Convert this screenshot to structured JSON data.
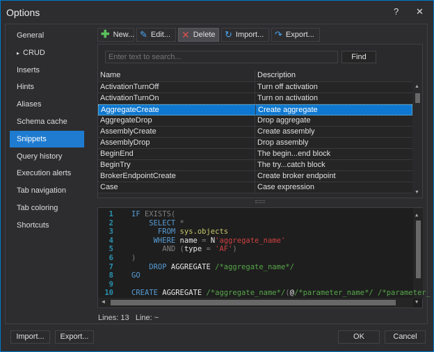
{
  "window": {
    "title": "Options",
    "help": "?",
    "close": "✕"
  },
  "sidebar": {
    "items": [
      {
        "label": "General"
      },
      {
        "label": "CRUD",
        "expander": "▸"
      },
      {
        "label": "Inserts"
      },
      {
        "label": "Hints"
      },
      {
        "label": "Aliases"
      },
      {
        "label": "Schema cache"
      },
      {
        "label": "Snippets",
        "selected": true
      },
      {
        "label": "Query history"
      },
      {
        "label": "Execution alerts"
      },
      {
        "label": "Tab navigation"
      },
      {
        "label": "Tab coloring"
      },
      {
        "label": "Shortcuts"
      }
    ]
  },
  "toolbar": {
    "new": "New...",
    "edit": "Edit...",
    "delete": "Delete",
    "import": "Import...",
    "export": "Export..."
  },
  "search": {
    "placeholder": "Enter text to search...",
    "find": "Find"
  },
  "table": {
    "headers": [
      "Name",
      "Description"
    ],
    "selected_index": 2,
    "rows": [
      [
        "ActivationTurnOff",
        "Turn off activation"
      ],
      [
        "ActivationTurnOn",
        "Turn on activation"
      ],
      [
        "AggregateCreate",
        "Create aggregate"
      ],
      [
        "AggregateDrop",
        "Drop aggregate"
      ],
      [
        "AssemblyCreate",
        "Create assembly"
      ],
      [
        "AssemblyDrop",
        "Drop assembly"
      ],
      [
        "BeginEnd",
        "The begin...end block"
      ],
      [
        "BeginTry",
        "The try...catch block"
      ],
      [
        "BrokerEndpointCreate",
        "Create broker endpoint"
      ],
      [
        "Case",
        "Case expression"
      ]
    ]
  },
  "editor": {
    "line_numbers": [
      "1",
      "2",
      "3",
      "4",
      "5",
      "6",
      "7",
      "8",
      "9",
      "10"
    ],
    "lines": [
      [
        [
          "kw",
          "IF "
        ],
        [
          "gr",
          "EXISTS("
        ]
      ],
      [
        [
          "kw",
          "    SELECT "
        ],
        [
          "gr",
          "*"
        ]
      ],
      [
        [
          "kw",
          "      FROM "
        ],
        [
          "ob",
          "sys.objects"
        ]
      ],
      [
        [
          "kw",
          "     WHERE "
        ],
        [
          "wh",
          "name "
        ],
        [
          "gr",
          "= "
        ],
        [
          "wh",
          "N"
        ],
        [
          "st",
          "'aggregate_name'"
        ]
      ],
      [
        [
          "gr",
          "       AND ("
        ],
        [
          "wh",
          "type "
        ],
        [
          "gr",
          "= "
        ],
        [
          "st",
          "'AF'"
        ],
        [
          "gr",
          ")"
        ]
      ],
      [
        [
          "gr",
          ")"
        ]
      ],
      [
        [
          "kw",
          "    DROP "
        ],
        [
          "wh",
          "AGGREGATE "
        ],
        [
          "cm",
          "/*aggregate_name*/"
        ]
      ],
      [
        [
          "kw",
          "GO"
        ]
      ],
      [
        [
          "wh",
          ""
        ]
      ],
      [
        [
          "kw",
          "CREATE "
        ],
        [
          "wh",
          "AGGREGATE "
        ],
        [
          "cm",
          "/*aggregate_name*/"
        ],
        [
          "gr",
          "("
        ],
        [
          "wh",
          "@"
        ],
        [
          "cm",
          "/*parameter_name*/ /*parameter_"
        ]
      ]
    ]
  },
  "status": {
    "lines_label": "Lines: 13",
    "line_label": "Line: ~"
  },
  "footer": {
    "import": "Import...",
    "export": "Export...",
    "ok": "OK",
    "cancel": "Cancel"
  },
  "colors": {
    "accent": "#007acc",
    "selection": "#0e78d0",
    "new_icon": "#5cc05c",
    "delete_icon": "#e05050",
    "import_export_icon": "#4aa3f0"
  }
}
